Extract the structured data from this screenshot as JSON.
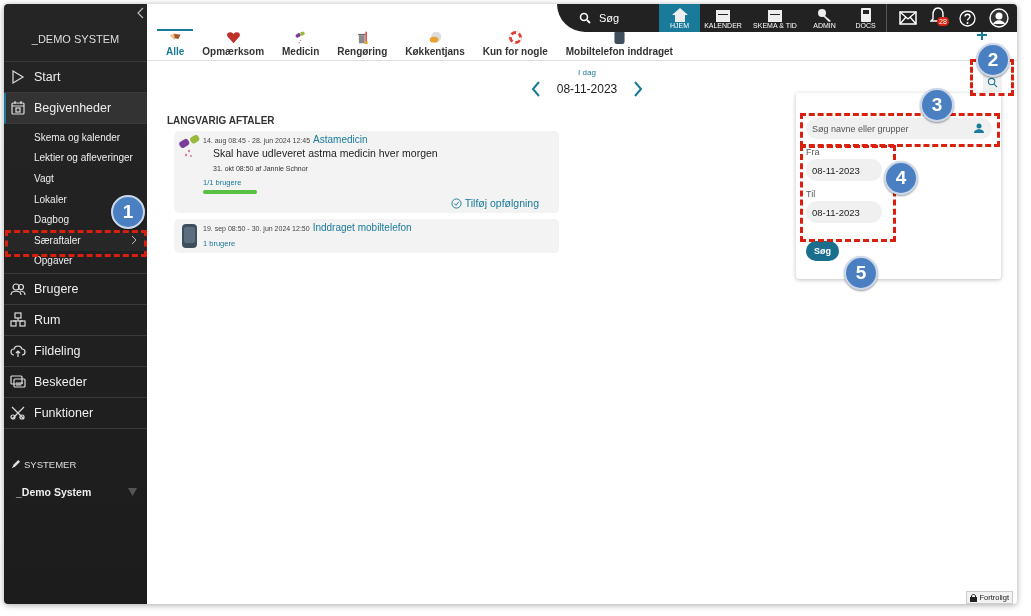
{
  "sidebar": {
    "system_title": "_DEMO SYSTEM",
    "items": [
      {
        "label": "Start",
        "selected": false
      },
      {
        "label": "Begivenheder",
        "selected": true,
        "children": [
          {
            "label": "Skema og kalender",
            "submenu": false
          },
          {
            "label": "Lektier og afleveringer",
            "submenu": false
          },
          {
            "label": "Vagt",
            "submenu": false
          },
          {
            "label": "Lokaler",
            "submenu": false
          },
          {
            "label": "Dagbog",
            "submenu": false
          },
          {
            "label": "Særaftaler",
            "submenu": true
          },
          {
            "label": "Opgaver",
            "submenu": false
          }
        ]
      },
      {
        "label": "Brugere",
        "selected": false
      },
      {
        "label": "Rum",
        "selected": false
      },
      {
        "label": "Fildeling",
        "selected": false
      },
      {
        "label": "Beskeder",
        "selected": false
      },
      {
        "label": "Funktioner",
        "selected": false
      }
    ],
    "systems_heading": "SYSTEMER",
    "system_select": "_Demo System"
  },
  "top_bar": {
    "search": "Søg",
    "nav": [
      {
        "label": "HJEM",
        "selected": true
      },
      {
        "label": "KALENDER",
        "selected": false
      },
      {
        "label": "SKEMA & TID",
        "selected": false
      },
      {
        "label": "ADMIN",
        "selected": false
      },
      {
        "label": "DOCS",
        "selected": false
      }
    ],
    "notification_count": "28"
  },
  "tabs": [
    {
      "label": "Alle",
      "selected": true
    },
    {
      "label": "Opmærksom",
      "selected": false
    },
    {
      "label": "Medicin",
      "selected": false
    },
    {
      "label": "Rengøring",
      "selected": false
    },
    {
      "label": "Køkkentjans",
      "selected": false
    },
    {
      "label": "Kun for nogle",
      "selected": false
    },
    {
      "label": "Mobiltelefon inddraget",
      "selected": false
    }
  ],
  "date_nav": {
    "today": "I dag",
    "date": "08-11-2023"
  },
  "section": {
    "title": "LANGVARIG AFTALER",
    "agreements": [
      {
        "kind": "medicine",
        "period": "14. aug 08:45 - 28. jun 2024 12:45",
        "title": "Astamedicin",
        "text": "Skal have udleveret astma medicin hver morgen",
        "meta": "31. okt 08:50 af Jannie Schnor",
        "users": "1/1 brugere",
        "level": 1,
        "action": "Tilføj opfølgning"
      },
      {
        "kind": "phone",
        "period": "19. sep 08:50 - 30. jun 2024 12:50",
        "title": "Inddraget mobiltelefon",
        "users": "1 brugere"
      }
    ]
  },
  "search_panel": {
    "placeholder": "Søg navne eller grupper",
    "from_label": "Fra",
    "from": "08-11-2023",
    "to_label": "Til",
    "to": "08-11-2023",
    "button": "Søg"
  },
  "footer_badge": "Fortroligt",
  "callouts": [
    {
      "number": "1",
      "boxed": true
    },
    {
      "number": "2",
      "boxed": true
    },
    {
      "number": "3",
      "boxed": true
    },
    {
      "number": "4",
      "boxed": true
    },
    {
      "number": "5",
      "boxed": false
    }
  ]
}
